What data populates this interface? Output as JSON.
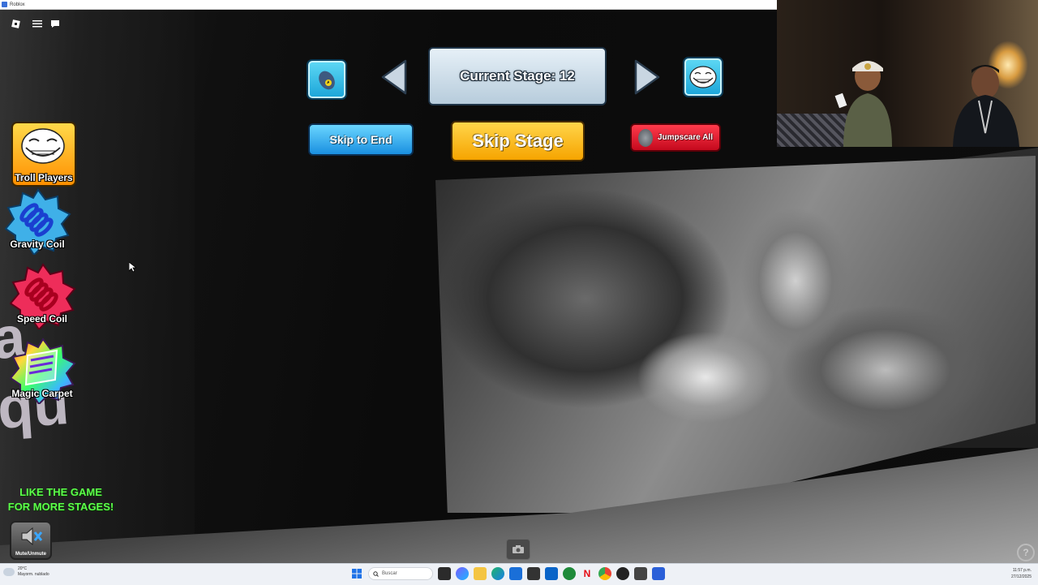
{
  "window": {
    "title": "Roblox"
  },
  "stage": {
    "current_label": "Current Stage: 12",
    "skip_to_end": "Skip to End",
    "skip_stage": "Skip Stage",
    "jumpscare_all": "Jumpscare All"
  },
  "tools": [
    {
      "label": "Troll Players",
      "icon": "troll-face-icon"
    },
    {
      "label": "Gravity Coil",
      "icon": "blue-coil-icon"
    },
    {
      "label": "Speed Coil",
      "icon": "red-coil-icon"
    },
    {
      "label": "Magic Carpet",
      "icon": "rainbow-carpet-icon"
    }
  ],
  "promo": {
    "line1": "LIKE THE GAME",
    "line2": "FOR MORE STAGES!"
  },
  "mute": {
    "label": "Mute/Unmute"
  },
  "scene": {
    "wall_text": "a\nqu"
  },
  "taskbar": {
    "weather_temp": "20°C",
    "weather_desc": "Mayorm. nublado",
    "search_placeholder": "Buscar",
    "time": "11:57 p.m.",
    "date": "27/12/2025"
  },
  "colors": {
    "skip_stage": "#f6a400",
    "skip_to_end": "#1a8fe0",
    "jumpscare": "#c5091d",
    "promo_text": "#5cff4a"
  }
}
